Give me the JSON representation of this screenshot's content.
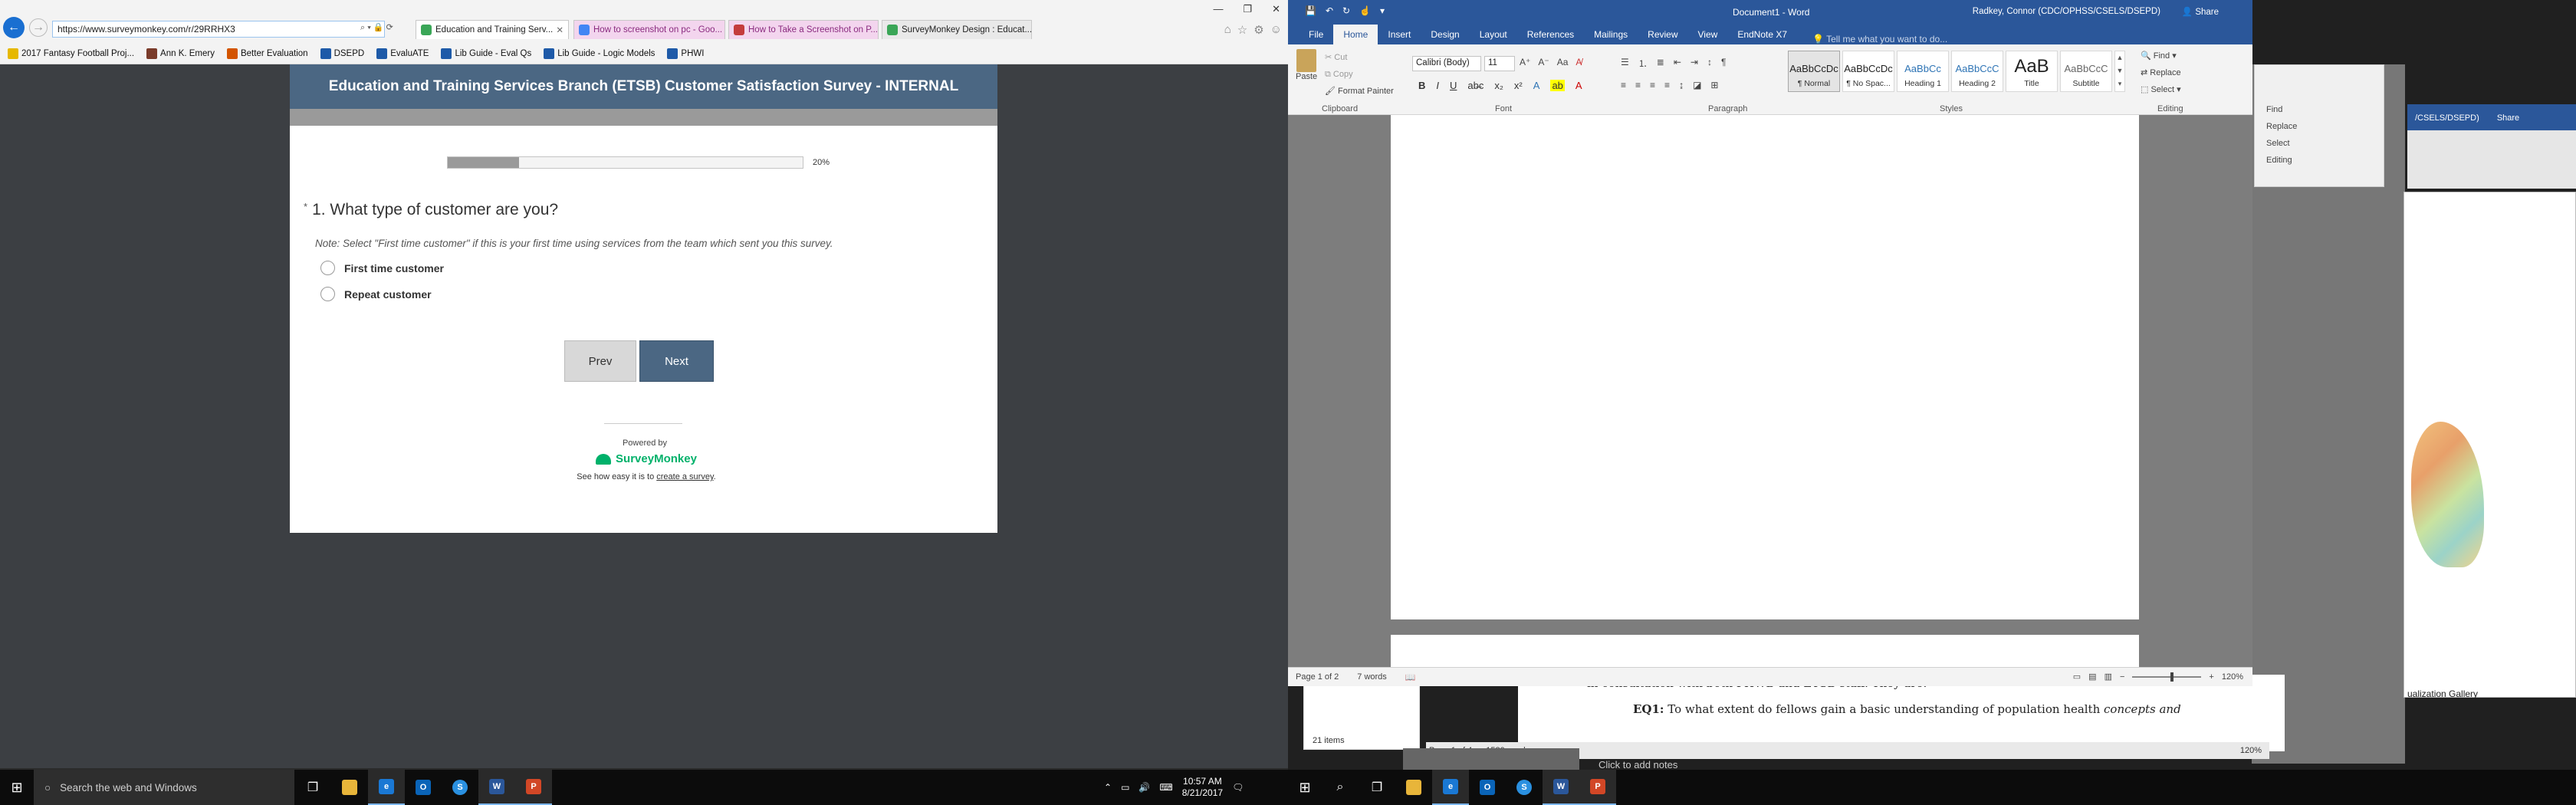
{
  "ie": {
    "address": "https://www.surveymonkey.com/r/29RRHX3",
    "tabs": [
      {
        "label": "Education and Training Serv..."
      },
      {
        "label": "How to screenshot on pc - Goo..."
      },
      {
        "label": "How to Take a Screenshot on P..."
      },
      {
        "label": "SurveyMonkey Design : Educat..."
      }
    ],
    "favorites": [
      "2017 Fantasy Football Proj...",
      "Ann K. Emery",
      "Better Evaluation",
      "DSEPD",
      "EvaluATE",
      "Lib Guide - Eval Qs",
      "Lib Guide - Logic Models",
      "PHWI"
    ]
  },
  "survey": {
    "header": "Education and Training Services Branch (ETSB) Customer Satisfaction Survey - INTERNAL",
    "progress_label": "20%",
    "progress_value": 0.2,
    "question": "1. What type of customer are you?",
    "required_mark": "*",
    "note": "Note: Select \"First time customer\" if this is your first time using services from the team which sent you this survey.",
    "options": [
      "First time customer",
      "Repeat customer"
    ],
    "prev_label": "Prev",
    "next_label": "Next",
    "powered_by": "Powered by",
    "brand": "SurveyMonkey",
    "see_how_prefix": "See how easy it is to ",
    "see_how_link": "create a survey",
    "see_how_suffix": "."
  },
  "taskbar": {
    "search_placeholder": "Search the web and Windows",
    "time": "10:57 AM",
    "date": "8/21/2017"
  },
  "word": {
    "doc_name": "Document1 - Word",
    "user": "Radkey, Connor (CDC/OPHSS/CSELS/DSEPD)",
    "share": "Share",
    "tabs": [
      "File",
      "Home",
      "Insert",
      "Design",
      "Layout",
      "References",
      "Mailings",
      "Review",
      "View",
      "EndNote X7"
    ],
    "tell_me": "Tell me what you want to do...",
    "clipboard": {
      "paste": "Paste",
      "cut": "Cut",
      "copy": "Copy",
      "format_painter": "Format Painter",
      "group": "Clipboard"
    },
    "font": {
      "name": "Calibri (Body)",
      "size": "11",
      "group": "Font"
    },
    "paragraph_group": "Paragraph",
    "styles_group": "Styles",
    "styles": [
      {
        "sample": "AaBbCcDc",
        "name": "¶ Normal"
      },
      {
        "sample": "AaBbCcDc",
        "name": "¶ No Spac..."
      },
      {
        "sample": "AaBbCc",
        "name": "Heading 1"
      },
      {
        "sample": "AaBbCcC",
        "name": "Heading 2"
      },
      {
        "sample": "AaB",
        "name": "Title"
      },
      {
        "sample": "AaBbCcC",
        "name": "Subtitle"
      }
    ],
    "editing": {
      "find": "Find",
      "replace": "Replace",
      "select": "Select",
      "group": "Editing"
    },
    "status_page": "Page 1 of 2",
    "status_words": "7 words",
    "zoom": "120%"
  },
  "behind": {
    "user_fragment": "/CSELS/DSEPD)",
    "share": "Share",
    "find": "Find",
    "replace": "Replace",
    "select": "Select",
    "editing": "Editing",
    "doc_line1": "in consultation with both PHWB and ETSB staff. They are:",
    "eq1_label": "EQ1:",
    "eq1_text": " To what extent do fellows gain a basic understanding of population health ",
    "eq1_italic": "concepts and",
    "status_page": "Page 1 of 4",
    "status_words": "1580 words",
    "zoom": "120%",
    "items": "21 items",
    "click_notes": "Click to add notes",
    "gallery": "ualization Gallery"
  }
}
